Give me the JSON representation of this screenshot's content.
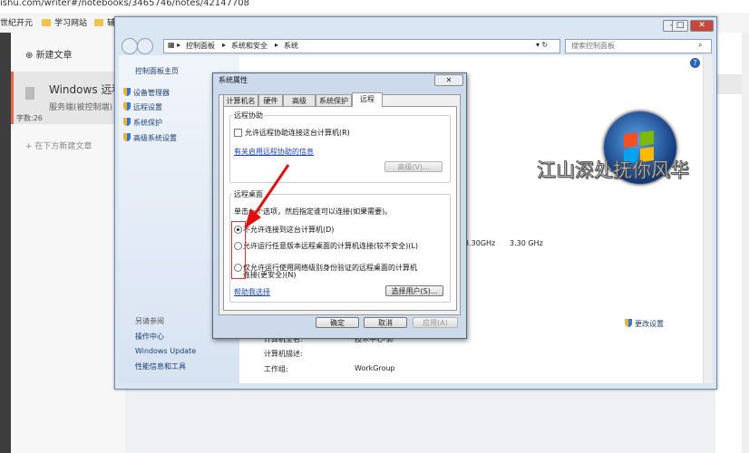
{
  "browser": {
    "url": "ishu.com/writer#/notebooks/3465746/notes/42147708",
    "bookmarks": [
      "世纪开元",
      "学习网站",
      "辅"
    ]
  },
  "editor": {
    "new_article": "新建文章",
    "article_title": "Windows 远程",
    "article_subtitle": "服务端(被控制端)",
    "word_count": "字数:26",
    "below_new": "在下方新建文章"
  },
  "control_panel": {
    "breadcrumb": [
      "控制面板",
      "系统和安全",
      "系统"
    ],
    "search_placeholder": "搜索控制面板",
    "sidebar_home": "控制面板主页",
    "sidebar_links": [
      "设备管理器",
      "远程设置",
      "系统保护",
      "高级系统设置"
    ],
    "see_also_title": "另请参阅",
    "see_also_links": [
      "操作中心",
      "Windows Update",
      "性能信息和工具"
    ],
    "cpu_freq_a": "3.30GHz",
    "cpu_freq_b": "3.30 GHz",
    "change_settings": "更改设置",
    "computer_name_label": "计算机全名:",
    "computer_name_value": "技术中心-郭",
    "computer_desc_label": "计算机描述:",
    "workgroup_label": "工作组:",
    "workgroup_value": "WorkGroup",
    "watermark": "江山深处抚你风华"
  },
  "dialog": {
    "title": "系统属性",
    "close": "✕",
    "tabs": [
      "计算机名",
      "硬件",
      "高级",
      "系统保护",
      "远程"
    ],
    "remote_assist": {
      "label": "远程协助",
      "checkbox": "允许远程协助连接这台计算机(R)",
      "link": "有关启用远程协助的信息",
      "advanced": "高级(V)..."
    },
    "remote_desktop": {
      "label": "远程桌面",
      "instruction": "单击一个选项，然后指定谁可以连接(如果需要)。",
      "options": [
        "不允许连接到这台计算机(D)",
        "允许运行任意版本远程桌面的计算机连接(较不安全)(L)",
        "仅允许运行使用网络级别身份验证的远程桌面的计算机",
        "连接(更安全)(N)"
      ],
      "help_link": "帮助我选择",
      "select_users": "选择用户(S)..."
    },
    "buttons": {
      "ok": "确定",
      "cancel": "取消",
      "apply": "应用(A)"
    }
  }
}
